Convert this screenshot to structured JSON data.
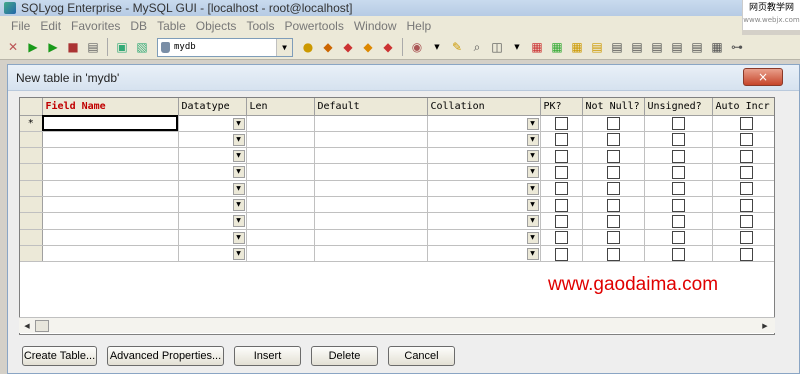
{
  "app": {
    "title": "SQLyog Enterprise - MySQL GUI - [localhost - root@localhost]",
    "watermark_top": "网页教学网",
    "watermark_top_sub": "www.webjx.com"
  },
  "menu": [
    "File",
    "Edit",
    "Favorites",
    "DB",
    "Table",
    "Objects",
    "Tools",
    "Powertools",
    "Window",
    "Help"
  ],
  "toolbar": {
    "db_selected": "mydb"
  },
  "dialog": {
    "title": "New table in 'mydb'",
    "close_label": "×",
    "columns": [
      "Field Name",
      "Datatype",
      "Len",
      "Default",
      "Collation",
      "PK?",
      "Not Null?",
      "Unsigned?",
      "Auto Incr"
    ],
    "row_marker": "*",
    "row_count": 9,
    "buttons": {
      "create": "Create Table...",
      "advanced": "Advanced Properties...",
      "insert": "Insert",
      "delete": "Delete",
      "cancel": "Cancel"
    }
  },
  "watermark_bottom": "www.gaodaima.com"
}
